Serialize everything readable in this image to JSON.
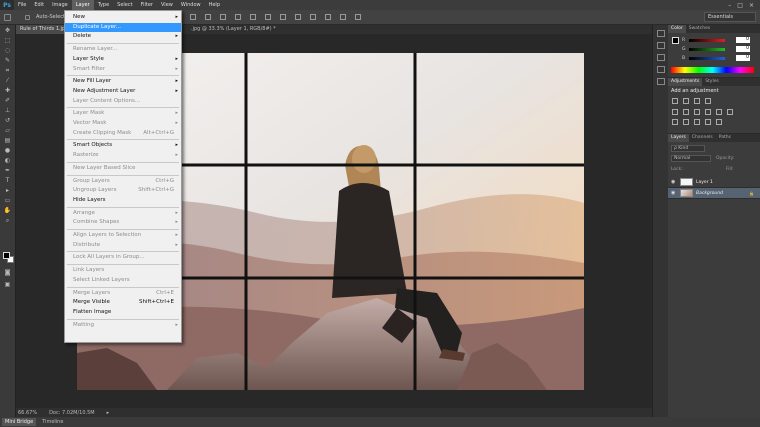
{
  "menubar": {
    "logo": "Ps",
    "items": [
      "File",
      "Edit",
      "Image",
      "Layer",
      "Type",
      "Select",
      "Filter",
      "View",
      "Window",
      "Help"
    ],
    "active_index": 3,
    "win_controls": [
      "–",
      "□",
      "×"
    ]
  },
  "options": {
    "auto_select_label": "Auto-Select:",
    "workspace": "Essentials"
  },
  "document": {
    "tab_title": "Rule of Thirds 1.jpg",
    "title_suffix": ".jpg @ 33.3% (Layer 1, RGB/8#) *"
  },
  "status": {
    "zoom": "66.67%",
    "doc": "Doc: 7.02M/10.5M"
  },
  "bottom_tabs": [
    "Mini Bridge",
    "Timeline"
  ],
  "color_panel": {
    "tabs": [
      "Color",
      "Swatches"
    ],
    "sliders": [
      {
        "label": "R",
        "value": "0",
        "color": "#e02020"
      },
      {
        "label": "G",
        "value": "0",
        "color": "#20c020"
      },
      {
        "label": "B",
        "value": "0",
        "color": "#2060e0"
      }
    ]
  },
  "adjustments_panel": {
    "tabs": [
      "Adjustments",
      "Styles"
    ],
    "title": "Add an adjustment"
  },
  "layers_panel": {
    "tabs": [
      "Layers",
      "Channels",
      "Paths"
    ],
    "kind": "Kind",
    "blend_mode": "Normal",
    "opacity_label": "Opacity:",
    "lock_label": "Lock:",
    "fill_label": "Fill:",
    "layers": [
      {
        "name": "Layer 1",
        "selected": false
      },
      {
        "name": "Background",
        "selected": true
      }
    ]
  },
  "layer_menu": {
    "items": [
      {
        "label": "New",
        "shortcut": "",
        "submenu": true,
        "disabled": false,
        "highlight": false,
        "sep_before": false
      },
      {
        "label": "Duplicate Layer...",
        "shortcut": "",
        "submenu": false,
        "disabled": false,
        "highlight": true,
        "sep_before": false
      },
      {
        "label": "Delete",
        "shortcut": "",
        "submenu": true,
        "disabled": false,
        "highlight": false,
        "sep_before": false
      },
      {
        "label": "Rename Layer...",
        "shortcut": "",
        "submenu": false,
        "disabled": true,
        "highlight": false,
        "sep_before": true
      },
      {
        "label": "Layer Style",
        "shortcut": "",
        "submenu": true,
        "disabled": false,
        "highlight": false,
        "sep_before": false
      },
      {
        "label": "Smart Filter",
        "shortcut": "",
        "submenu": true,
        "disabled": true,
        "highlight": false,
        "sep_before": false
      },
      {
        "label": "New Fill Layer",
        "shortcut": "",
        "submenu": true,
        "disabled": false,
        "highlight": false,
        "sep_before": true
      },
      {
        "label": "New Adjustment Layer",
        "shortcut": "",
        "submenu": true,
        "disabled": false,
        "highlight": false,
        "sep_before": false
      },
      {
        "label": "Layer Content Options...",
        "shortcut": "",
        "submenu": false,
        "disabled": true,
        "highlight": false,
        "sep_before": false
      },
      {
        "label": "Layer Mask",
        "shortcut": "",
        "submenu": true,
        "disabled": true,
        "highlight": false,
        "sep_before": true
      },
      {
        "label": "Vector Mask",
        "shortcut": "",
        "submenu": true,
        "disabled": true,
        "highlight": false,
        "sep_before": false
      },
      {
        "label": "Create Clipping Mask",
        "shortcut": "Alt+Ctrl+G",
        "submenu": false,
        "disabled": true,
        "highlight": false,
        "sep_before": false
      },
      {
        "label": "Smart Objects",
        "shortcut": "",
        "submenu": true,
        "disabled": false,
        "highlight": false,
        "sep_before": true
      },
      {
        "label": "Rasterize",
        "shortcut": "",
        "submenu": true,
        "disabled": true,
        "highlight": false,
        "sep_before": false
      },
      {
        "label": "New Layer Based Slice",
        "shortcut": "",
        "submenu": false,
        "disabled": true,
        "highlight": false,
        "sep_before": true
      },
      {
        "label": "Group Layers",
        "shortcut": "Ctrl+G",
        "submenu": false,
        "disabled": true,
        "highlight": false,
        "sep_before": true
      },
      {
        "label": "Ungroup Layers",
        "shortcut": "Shift+Ctrl+G",
        "submenu": false,
        "disabled": true,
        "highlight": false,
        "sep_before": false
      },
      {
        "label": "Hide Layers",
        "shortcut": "",
        "submenu": false,
        "disabled": false,
        "highlight": false,
        "sep_before": false
      },
      {
        "label": "Arrange",
        "shortcut": "",
        "submenu": true,
        "disabled": true,
        "highlight": false,
        "sep_before": true
      },
      {
        "label": "Combine Shapes",
        "shortcut": "",
        "submenu": true,
        "disabled": true,
        "highlight": false,
        "sep_before": false
      },
      {
        "label": "Align Layers to Selection",
        "shortcut": "",
        "submenu": true,
        "disabled": true,
        "highlight": false,
        "sep_before": true
      },
      {
        "label": "Distribute",
        "shortcut": "",
        "submenu": true,
        "disabled": true,
        "highlight": false,
        "sep_before": false
      },
      {
        "label": "Lock All Layers in Group...",
        "shortcut": "",
        "submenu": false,
        "disabled": true,
        "highlight": false,
        "sep_before": true
      },
      {
        "label": "Link Layers",
        "shortcut": "",
        "submenu": false,
        "disabled": true,
        "highlight": false,
        "sep_before": true
      },
      {
        "label": "Select Linked Layers",
        "shortcut": "",
        "submenu": false,
        "disabled": true,
        "highlight": false,
        "sep_before": false
      },
      {
        "label": "Merge Layers",
        "shortcut": "Ctrl+E",
        "submenu": false,
        "disabled": true,
        "highlight": false,
        "sep_before": true
      },
      {
        "label": "Merge Visible",
        "shortcut": "Shift+Ctrl+E",
        "submenu": false,
        "disabled": false,
        "highlight": false,
        "sep_before": false
      },
      {
        "label": "Flatten Image",
        "shortcut": "",
        "submenu": false,
        "disabled": false,
        "highlight": false,
        "sep_before": false
      },
      {
        "label": "Matting",
        "shortcut": "",
        "submenu": true,
        "disabled": true,
        "highlight": false,
        "sep_before": true
      }
    ]
  },
  "photo": {
    "grid_color": "#111111",
    "grid_lines": 2
  }
}
